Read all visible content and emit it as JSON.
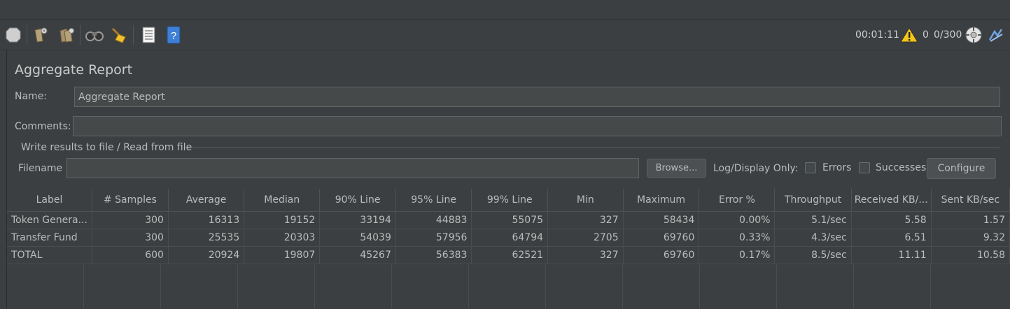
{
  "toolbar": {
    "icons": [
      {
        "name": "stop-icon"
      },
      {
        "name": "clear-icon"
      },
      {
        "name": "clear-all-icon"
      },
      {
        "name": "search-icon"
      },
      {
        "name": "reset-search-icon"
      },
      {
        "name": "function-helper-icon"
      },
      {
        "name": "help-icon"
      }
    ],
    "elapsed": "00:01:11",
    "warning_count": "0",
    "threads": "0/300"
  },
  "panel": {
    "title": "Aggregate Report",
    "name_label": "Name:",
    "name_value": "Aggregate Report",
    "comments_label": "Comments:",
    "comments_value": "",
    "group_label": "Write results to file / Read from file",
    "filename_label": "Filename",
    "filename_value": "",
    "browse_label": "Browse...",
    "log_display_label": "Log/Display Only:",
    "errors_label": "Errors",
    "successes_label": "Successes",
    "configure_label": "Configure"
  },
  "table": {
    "columns": [
      "Label",
      "# Samples",
      "Average",
      "Median",
      "90% Line",
      "95% Line",
      "99% Line",
      "Min",
      "Maximum",
      "Error %",
      "Throughput",
      "Received KB/...",
      "Sent KB/sec"
    ],
    "rows": [
      [
        "Token Genera...",
        "300",
        "16313",
        "19152",
        "33194",
        "44883",
        "55075",
        "327",
        "58434",
        "0.00%",
        "5.1/sec",
        "5.58",
        "1.57"
      ],
      [
        "Transfer Fund",
        "300",
        "25535",
        "20303",
        "54039",
        "57956",
        "64794",
        "2705",
        "69760",
        "0.33%",
        "4.3/sec",
        "6.51",
        "9.32"
      ],
      [
        "TOTAL",
        "600",
        "20924",
        "19807",
        "45267",
        "56383",
        "62521",
        "327",
        "69760",
        "0.17%",
        "8.5/sec",
        "11.11",
        "10.58"
      ]
    ]
  }
}
